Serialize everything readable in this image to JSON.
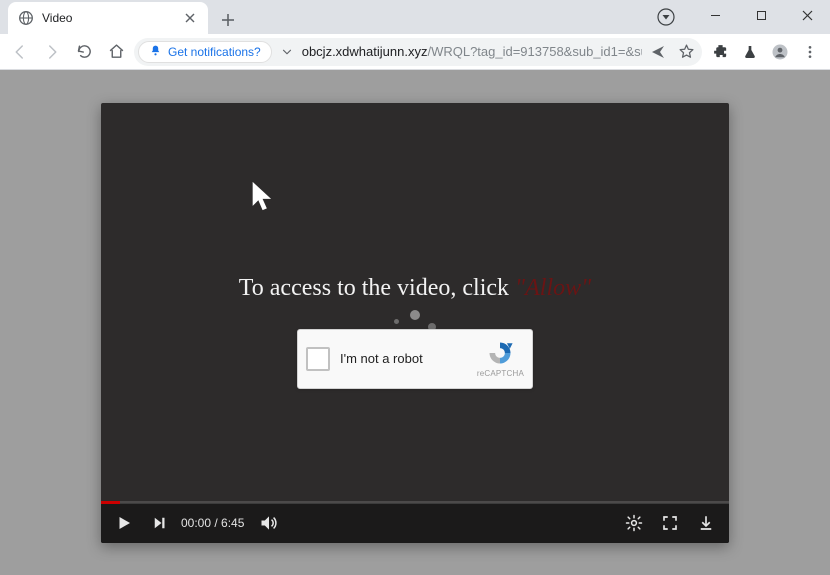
{
  "window": {
    "tab_title": "Video"
  },
  "toolbar": {
    "notification_prompt": "Get notifications?",
    "url_host": "obcjz.xdwhatijunn.xyz",
    "url_path": "/WRQL?tag_id=913758&sub_id1=&sub_id2=3567..."
  },
  "page": {
    "headline_pre": "To access to the video, click ",
    "headline_allow": "\"Allow\"",
    "captcha_label": "I'm not a robot",
    "captcha_brand": "reCAPTCHA"
  },
  "player": {
    "time_current": "00:00",
    "time_sep": " / ",
    "time_total": "6:45"
  }
}
